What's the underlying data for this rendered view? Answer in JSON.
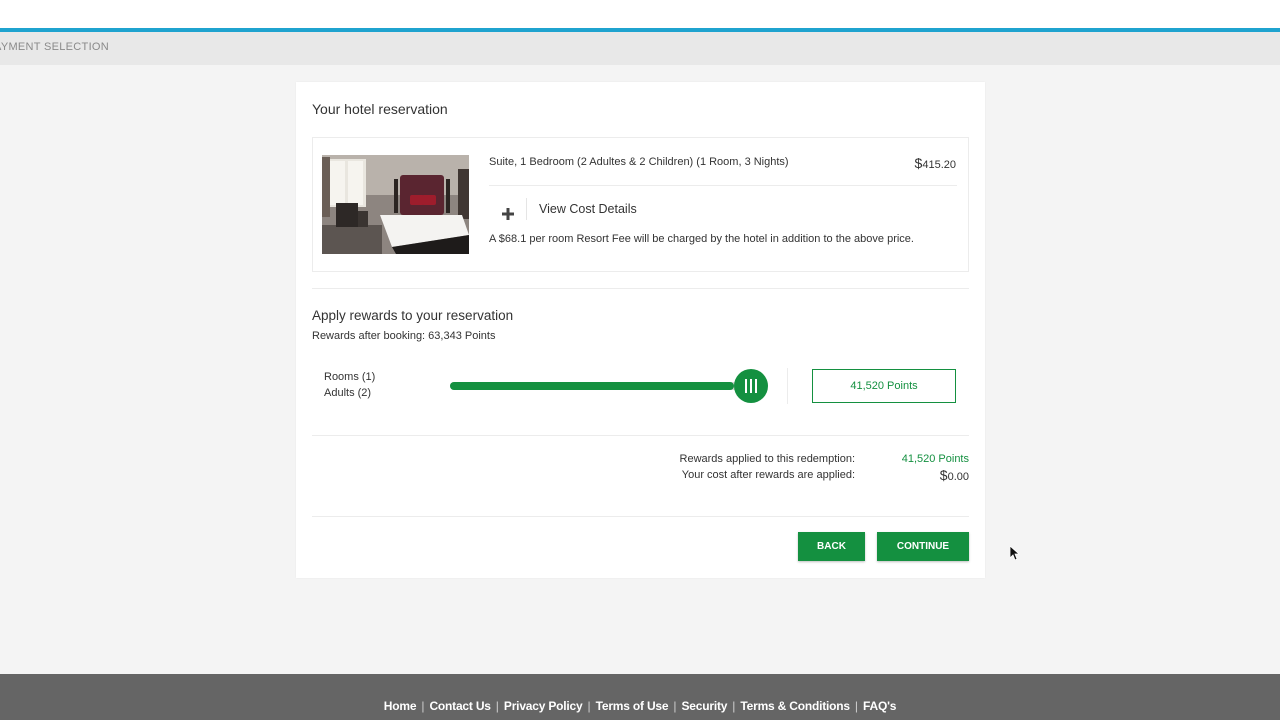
{
  "header": {
    "step_label": "AYMENT SELECTION"
  },
  "colors": {
    "accent_green": "#149040",
    "top_border_blue": "#1fa3cf",
    "footer_gray": "#656565"
  },
  "reservation": {
    "title": "Your hotel reservation",
    "room_description": "Suite, 1 Bedroom (2 Adultes & 2 Children) (1 Room, 3 Nights)",
    "price_currency": "$",
    "price_amount": "415.20",
    "expand_icon": "plus-icon",
    "view_cost_label": "View Cost Details",
    "resort_fee_note": "A $68.1 per room Resort Fee will be charged by the hotel in addition to the above price."
  },
  "rewards": {
    "title": "Apply rewards to your reservation",
    "after_booking": "Rewards after booking: 63,343 Points",
    "rooms_label": "Rooms (1)",
    "adults_label": "Adults (2)",
    "slider_fraction": 1.0,
    "points_value": "41,520  Points",
    "applied_label": "Rewards applied to this redemption:",
    "applied_value": "41,520 Points",
    "cost_label": "Your cost after rewards are applied:",
    "cost_currency": "$",
    "cost_amount": "0.00"
  },
  "actions": {
    "back_label": "BACK",
    "continue_label": "CONTINUE"
  },
  "footer": {
    "links": [
      "Home",
      "Contact Us",
      "Privacy Policy",
      "Terms of Use",
      "Security",
      "Terms & Conditions",
      "FAQ's"
    ]
  }
}
